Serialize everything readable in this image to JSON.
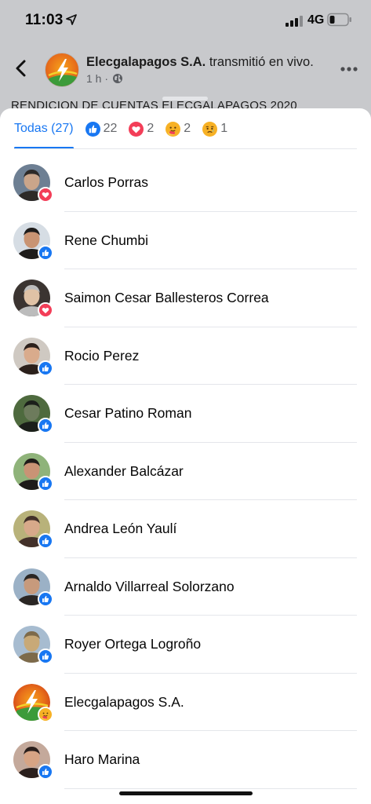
{
  "status_bar": {
    "time": "11:03",
    "network": "4G"
  },
  "post": {
    "page_name": "Elecgalapagos S.A.",
    "action": " transmitió en vivo.",
    "time_ago": "1 h ·",
    "peek_text": "RENDICION DE CUENTAS ELECGALAPAGOS 2020"
  },
  "tabs": [
    {
      "label": "Todas (27)",
      "type": "all"
    },
    {
      "label": "22",
      "type": "like"
    },
    {
      "label": "2",
      "type": "love"
    },
    {
      "label": "2",
      "type": "care"
    },
    {
      "label": "1",
      "type": "sad"
    }
  ],
  "people": [
    {
      "name": "Carlos Porras",
      "reaction": "love"
    },
    {
      "name": "Rene Chumbi",
      "reaction": "like"
    },
    {
      "name": "Saimon Cesar Ballesteros Correa",
      "reaction": "love"
    },
    {
      "name": "Rocio Perez",
      "reaction": "like"
    },
    {
      "name": "Cesar Patino Roman",
      "reaction": "like"
    },
    {
      "name": "Alexander Balcázar",
      "reaction": "like"
    },
    {
      "name": "Andrea León Yaulí",
      "reaction": "like"
    },
    {
      "name": "Arnaldo Villarreal Solorzano",
      "reaction": "like"
    },
    {
      "name": "Royer Ortega Logroño",
      "reaction": "like"
    },
    {
      "name": "Elecgalapagos S.A.",
      "reaction": "care"
    },
    {
      "name": "Haro Marina",
      "reaction": "like"
    }
  ],
  "colors": {
    "accent": "#1877f2",
    "like": "#1877f2",
    "love": "#f33e58",
    "care": "#f7b125",
    "sad": "#f7b125"
  },
  "icons": [
    "back-arrow-icon",
    "globe-icon",
    "more-icon",
    "like-icon",
    "love-icon",
    "care-icon",
    "sad-icon",
    "location-arrow-icon",
    "signal-icon",
    "battery-icon"
  ]
}
